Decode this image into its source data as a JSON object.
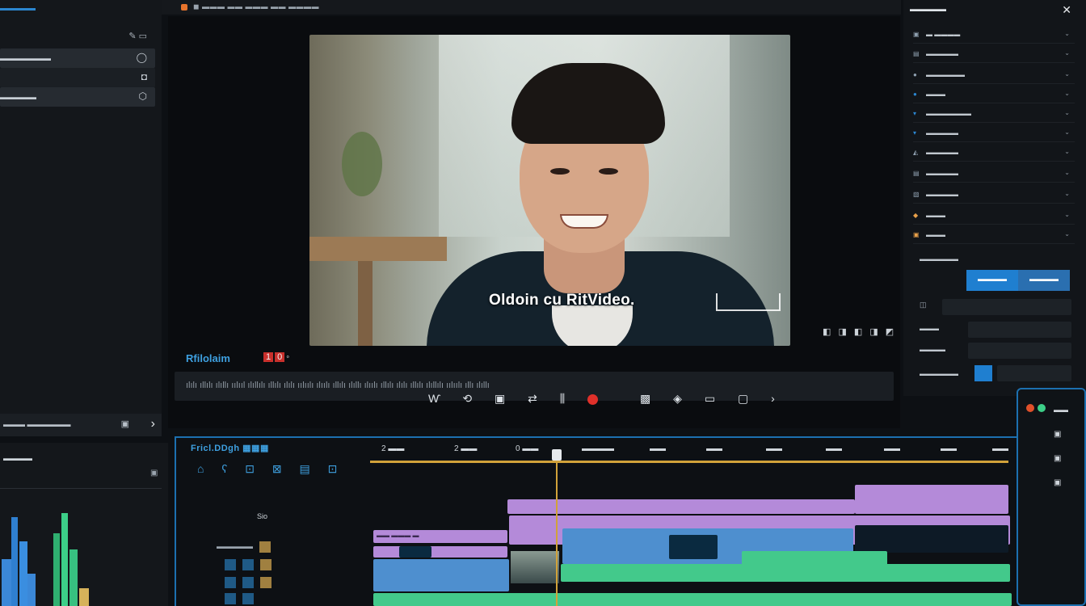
{
  "topbar": {
    "title": "◼ ▬▬▬ ▬▬ ▬▬▬ ▬▬ ▬▬▬▬"
  },
  "left_panel": {
    "tools": "✎ ▭",
    "rows": [
      {
        "label": "▬▬▬▬▬▬▬",
        "icon": "◯"
      },
      {
        "label": "",
        "icon": "◘"
      },
      {
        "label": "▬▬▬▬▬",
        "icon": "⬡"
      }
    ],
    "footer": "▬▬▬ ▬▬▬▬▬▬",
    "footer_icon": "▣",
    "next": "›"
  },
  "monitor": {
    "caption": "Oldoin cu RitVideo.",
    "timecode": "Rfilolaim",
    "red_code": [
      "1",
      "0"
    ],
    "red_suffix": "◦",
    "controls": "◧ ◨ ◧ ◨ ◩",
    "scrub_text": "ılılı ıllılı ılıllı ıılııl ılıllılı ıllılı ılılı ıılıılı ılıılı ıllılı ılıllı ılıılı ıllılı ılılı ıllılı ılıllılı ıılıılı ıllı ılıllı",
    "transport": {
      "a": "Ⱳ",
      "b": "⟲",
      "c": "▣",
      "d": "⇄",
      "e": "⫼",
      "f": "▩",
      "g": "◈",
      "h": "▭",
      "i": "▢",
      "j": "›"
    }
  },
  "right_panel": {
    "header": "▬▬▬▬▬",
    "close": "✕",
    "rows": [
      {
        "icon": "▣",
        "label": "▬ ▬▬▬▬"
      },
      {
        "icon": "▤",
        "label": "▬▬▬▬▬"
      },
      {
        "icon": "●",
        "label": "▬▬▬▬▬▬"
      },
      {
        "icon": "●",
        "label": "▬▬▬"
      },
      {
        "icon": "▾",
        "label": "▬▬▬▬▬▬▬"
      },
      {
        "icon": "▾",
        "label": "▬▬▬▬▬"
      },
      {
        "icon": "◭",
        "label": "▬▬▬▬▬"
      },
      {
        "icon": "▤",
        "label": "▬▬▬▬▬"
      },
      {
        "icon": "▧",
        "label": "▬▬▬▬▬"
      },
      {
        "icon": "◆",
        "label": "▬▬▬"
      },
      {
        "icon": "▣",
        "label": "▬▬▬"
      }
    ],
    "section_label": "▬▬▬▬▬▬",
    "btn_a": "▬▬▬▬",
    "btn_b": "▬▬▬▬",
    "field_rows": [
      {
        "icon": "◫",
        "label": ""
      },
      {
        "icon": "▤",
        "label": "▬▬▬"
      },
      {
        "icon": "▤",
        "label": "▬▬▬▬"
      },
      {
        "icon": "",
        "label": "▬▬▬▬▬▬"
      }
    ]
  },
  "timeline": {
    "title": "Fricl.DDgh ▦▦▦",
    "tools": [
      "⌂",
      "ʕ",
      "⊡",
      "⊠",
      "▤",
      "⊡"
    ],
    "subtitle": "Sio",
    "track_label_a": "▬▬▬▬▬",
    "ruler": [
      "2 ▬▬",
      "2 ▬▬",
      "0 ▬▬",
      "▬▬▬▬",
      "▬▬",
      "▬▬",
      "▬▬",
      "▬▬",
      "▬▬",
      "▬▬",
      "▬▬"
    ],
    "clip_label": "▬▬ ▬▬▬ ▬"
  },
  "scopes": {
    "title": "▬▬▬▬"
  },
  "colors": {
    "accent_blue": "#3ea0e0",
    "playhead": "#d1a23a",
    "clip_purple": "#b48ad9",
    "clip_blue": "#4e8fcf",
    "clip_green": "#43c98b",
    "record_red": "#e0302a"
  }
}
